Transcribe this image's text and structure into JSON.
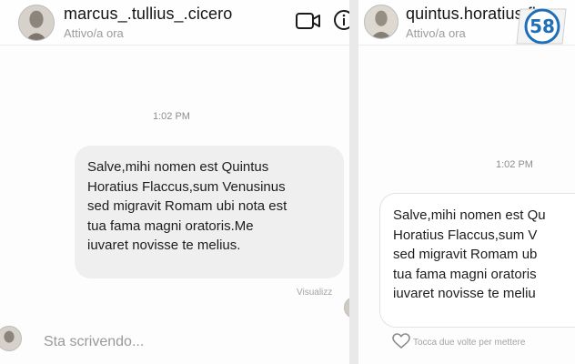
{
  "left_chat": {
    "username": "marcus_.tullius_.cicero",
    "status": "Attivo/a ora",
    "timestamp": "1:02 PM",
    "message": "Salve,mihi nomen est Quintus\nHoratius Flaccus,sum Venusinus\nsed migravit Romam ubi nota est\ntua fama magni oratoris.Me\niuvaret novisse te melius.",
    "seen_label": "Visualizz",
    "composer_placeholder": "Sta scrivendo...",
    "icons": [
      "video-call-icon",
      "info-icon"
    ]
  },
  "right_chat": {
    "username": "quintus.horatius.flac",
    "status": "Attivo/a ora",
    "timestamp": "1:02 PM",
    "message": "Salve,mihi nomen est Qu\nHoratius Flaccus,sum V\nsed migravit Romam ub\ntua fama magni oratoris\niuvaret novisse te meliu",
    "like_hint": "Tocca due volte per mettere",
    "icons": [
      "heart-icon"
    ]
  },
  "logo": {
    "text": "58",
    "color": "#1f6fb8"
  }
}
